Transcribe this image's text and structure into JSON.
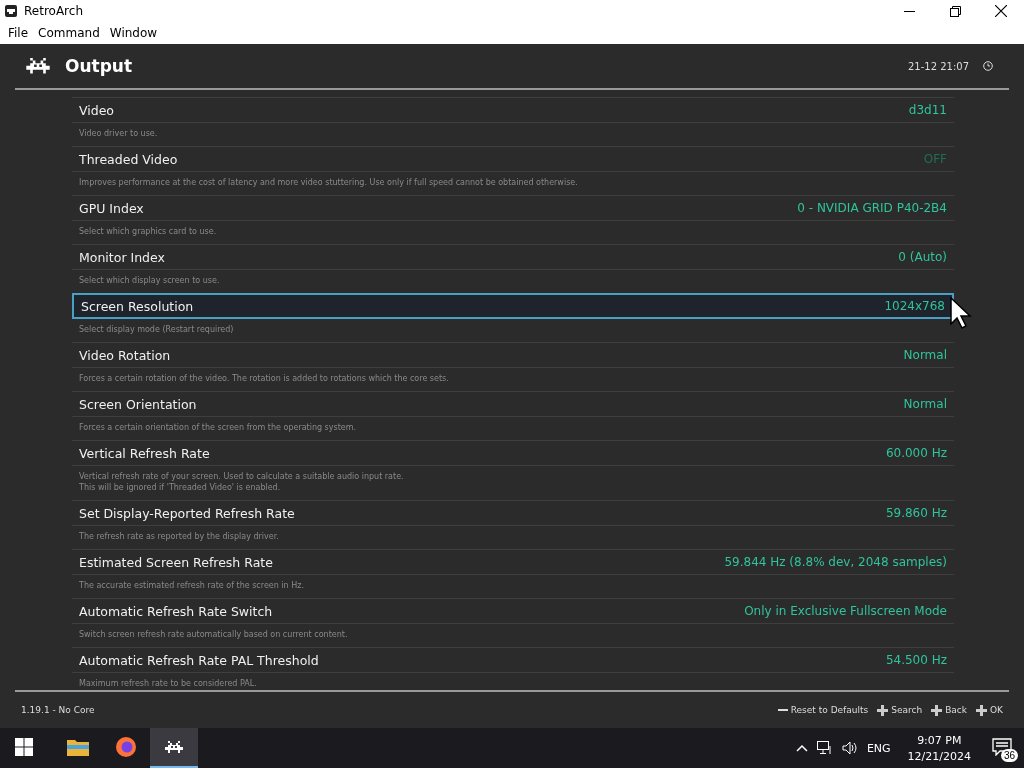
{
  "window": {
    "title": "RetroArch"
  },
  "menu": [
    "File",
    "Command",
    "Window"
  ],
  "header": {
    "title": "Output",
    "clock": "21-12 21:07"
  },
  "settings": [
    {
      "label": "Video",
      "description": [
        "Video driver to use."
      ],
      "value": "d3d11",
      "dimmed": false,
      "selected": false
    },
    {
      "label": "Threaded Video",
      "description": [
        "Improves performance at the cost of latency and more video stuttering. Use only if full speed cannot be obtained otherwise."
      ],
      "value": "OFF",
      "dimmed": true,
      "selected": false
    },
    {
      "label": "GPU Index",
      "description": [
        "Select which graphics card to use."
      ],
      "value": "0 - NVIDIA GRID P40-2B4",
      "dimmed": false,
      "selected": false
    },
    {
      "label": "Monitor Index",
      "description": [
        "Select which display screen to use."
      ],
      "value": "0 (Auto)",
      "dimmed": false,
      "selected": false
    },
    {
      "label": "Screen Resolution",
      "description": [
        "Select display mode (Restart required)"
      ],
      "value": "1024x768",
      "dimmed": false,
      "selected": true
    },
    {
      "label": "Video Rotation",
      "description": [
        "Forces a certain rotation of the video. The rotation is added to rotations which the core sets."
      ],
      "value": "Normal",
      "dimmed": false,
      "selected": false
    },
    {
      "label": "Screen Orientation",
      "description": [
        "Forces a certain orientation of the screen from the operating system."
      ],
      "value": "Normal",
      "dimmed": false,
      "selected": false
    },
    {
      "label": "Vertical Refresh Rate",
      "description": [
        "Vertical refresh rate of your screen. Used to calculate a suitable audio input rate.",
        "This will be ignored if 'Threaded Video' is enabled."
      ],
      "value": "60.000 Hz",
      "dimmed": false,
      "selected": false
    },
    {
      "label": "Set Display-Reported Refresh Rate",
      "description": [
        "The refresh rate as reported by the display driver."
      ],
      "value": "59.860 Hz",
      "dimmed": false,
      "selected": false
    },
    {
      "label": "Estimated Screen Refresh Rate",
      "description": [
        "The accurate estimated refresh rate of the screen in Hz."
      ],
      "value": "59.844 Hz (8.8% dev, 2048 samples)",
      "dimmed": false,
      "selected": false
    },
    {
      "label": "Automatic Refresh Rate Switch",
      "description": [
        "Switch screen refresh rate automatically based on current content."
      ],
      "value": "Only in Exclusive Fullscreen Mode",
      "dimmed": false,
      "selected": false
    },
    {
      "label": "Automatic Refresh Rate PAL Threshold",
      "description": [
        "Maximum refresh rate to be considered PAL."
      ],
      "value": "54.500 Hz",
      "dimmed": false,
      "selected": false
    }
  ],
  "footer": {
    "version": "1.19.1 - No Core",
    "actions": [
      {
        "kind": "reset",
        "label": "Reset to Defaults"
      },
      {
        "kind": "pad",
        "label": "Search"
      },
      {
        "kind": "pad",
        "label": "Back"
      },
      {
        "kind": "pad",
        "label": "OK"
      }
    ]
  },
  "taskbar": {
    "apps": [
      {
        "kind": "folder",
        "selected": false
      },
      {
        "kind": "browser",
        "selected": false
      },
      {
        "kind": "retroarch",
        "selected": true
      }
    ],
    "language": "ENG",
    "time": "9:07 PM",
    "date": "12/21/2024",
    "notifications": "36"
  }
}
